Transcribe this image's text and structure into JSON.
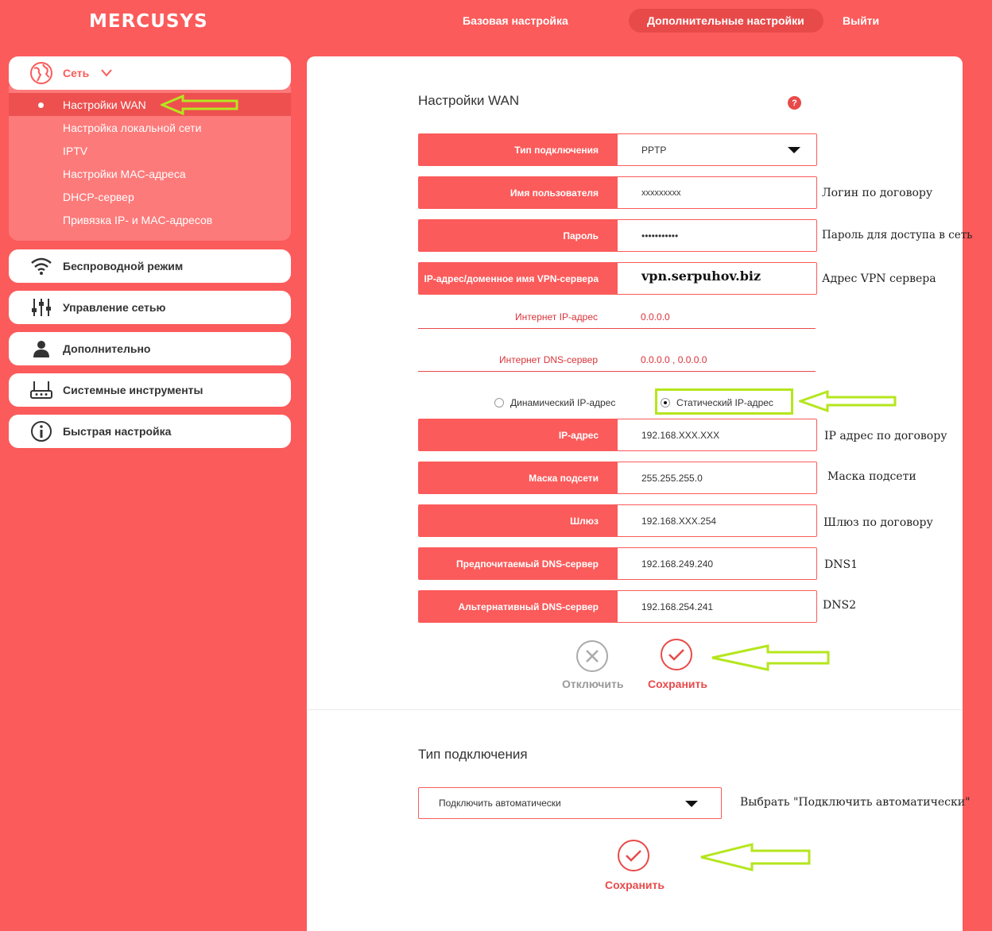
{
  "header": {
    "logo": "MERCUSYS",
    "nav": [
      "Базовая настройка",
      "Дополнительные настройки",
      "Выйти"
    ]
  },
  "sidebar": {
    "network": "Сеть",
    "sub": [
      "Настройки WAN",
      "Настройка локальной сети",
      "IPTV",
      "Настройки MAC-адреса",
      "DHCP-сервер",
      "Привязка IP- и MAC-адресов"
    ],
    "items": [
      "Беспроводной режим",
      "Управление сетью",
      "Дополнительно",
      "Системные инструменты",
      "Быстрая настройка"
    ]
  },
  "wan": {
    "title": "Настройки WAN",
    "help": "?",
    "fields": [
      {
        "label": "Тип подключения",
        "value": "PPTP"
      },
      {
        "label": "Имя пользователя",
        "value": "xxxxxxxxx"
      },
      {
        "label": "Пароль",
        "value": "•••••••••••"
      },
      {
        "label": "IP-адрес/доменное имя VPN-сервера",
        "value": "vpn.serpuhov.biz"
      }
    ],
    "info": [
      {
        "label": "Интернет IP-адрес",
        "value": "0.0.0.0"
      },
      {
        "label": "Интернет DNS-сервер",
        "value": "0.0.0.0 , 0.0.0.0"
      }
    ],
    "radio_dynamic": "Динамический IP-адрес",
    "radio_static": "Статический IP-адрес",
    "static_fields": [
      {
        "label": "IP-адрес",
        "value": "192.168.XXX.XXX"
      },
      {
        "label": "Маска подсети",
        "value": "255.255.255.0"
      },
      {
        "label": "Шлюз",
        "value": "192.168.XXX.254"
      },
      {
        "label": "Предпочитаемый DNS-сервер",
        "value": "192.168.249.240"
      },
      {
        "label": "Альтернативный DNS-сервер",
        "value": "192.168.254.241"
      }
    ],
    "disconnect": "Отключить",
    "save": "Сохранить"
  },
  "notes": {
    "login": "Логин по договору",
    "password": "Пароль для доступа в сеть",
    "vpn": "Адрес VPN сервера",
    "ip": "IP адрес по договору",
    "mask": "Маска подсети",
    "gw": "Шлюз по договору",
    "dns1": "DNS1",
    "dns2": "DNS2",
    "auto": "Выбрать \"Подключить автоматически\""
  },
  "conn": {
    "title": "Тип подключения",
    "value": "Подключить автоматически",
    "save": "Сохранить"
  },
  "colors": {
    "accent": "#fb5b5b",
    "arrow": "#b5e61d"
  }
}
